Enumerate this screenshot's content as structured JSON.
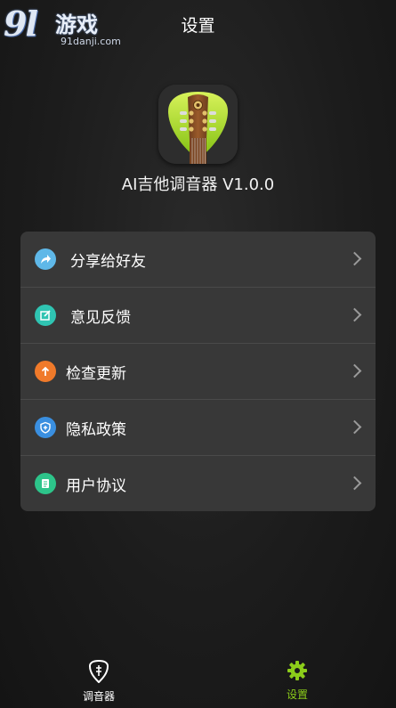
{
  "watermark": {
    "big": "9l",
    "cn": "游戏",
    "url": "91danji.com"
  },
  "header": {
    "title": "设置"
  },
  "app": {
    "name": "AI吉他调音器 V1.0.0"
  },
  "menu": {
    "items": [
      {
        "label": "分享给好友",
        "icon": "share-icon",
        "color": "#5fb8e8"
      },
      {
        "label": "意见反馈",
        "icon": "edit-icon",
        "color": "#2fc4b2"
      },
      {
        "label": "检查更新",
        "icon": "update-icon",
        "color": "#f07a2a"
      },
      {
        "label": "隐私政策",
        "icon": "privacy-shield-icon",
        "color": "#3a8fe0"
      },
      {
        "label": "用户协议",
        "icon": "document-icon",
        "color": "#2dc48a"
      }
    ]
  },
  "tabbar": {
    "tabs": [
      {
        "label": "调音器",
        "icon": "tuner-icon",
        "active": false
      },
      {
        "label": "设置",
        "icon": "gear-icon",
        "active": true
      }
    ],
    "active_color": "#8ccd1a",
    "inactive_color": "#ffffff"
  }
}
